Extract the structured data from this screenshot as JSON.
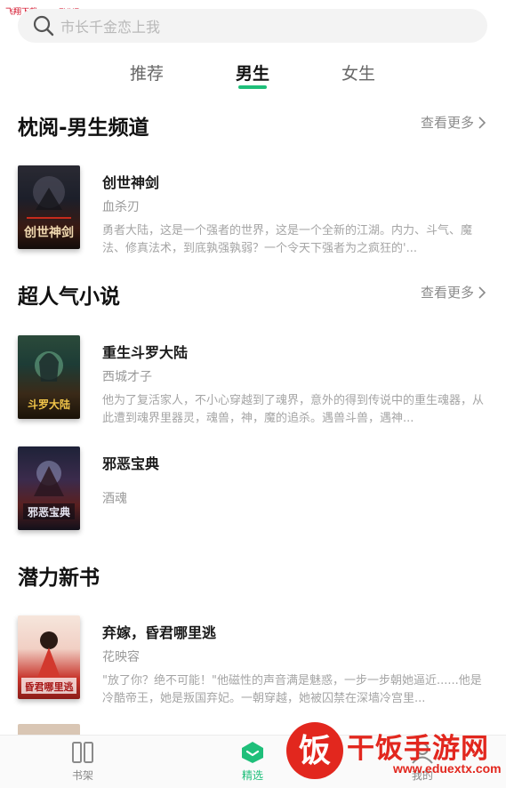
{
  "watermark_top": "飞翔下载 www.FXXZ.com",
  "search": {
    "placeholder": "市长千金恋上我"
  },
  "tabs": [
    {
      "label": "推荐"
    },
    {
      "label": "男生"
    },
    {
      "label": "女生"
    }
  ],
  "sections": [
    {
      "title": "枕阅-男生频道",
      "more": "查看更多",
      "books": [
        {
          "title": "创世神剑",
          "author": "血杀刃",
          "cover_text": "创世神剑",
          "desc": "勇者大陆，这是一个强者的世界，这是一个全新的江湖。内力、斗气、魔法、修真法术，到底孰强孰弱？一个令天下强者为之疯狂的'..."
        }
      ]
    },
    {
      "title": "超人气小说",
      "more": "查看更多",
      "books": [
        {
          "title": "重生斗罗大陆",
          "author": "西城才子",
          "cover_text": "斗罗大陆",
          "desc": "他为了复活家人，不小心穿越到了魂界，意外的得到传说中的重生魂器，从此遭到魂界里器灵，魂兽，神，魔的追杀。遇兽斗兽，遇神..."
        },
        {
          "title": "邪恶宝典",
          "author": "酒魂",
          "cover_text": "邪恶宝典",
          "desc": ""
        }
      ]
    },
    {
      "title": "潜力新书",
      "more": "",
      "books": [
        {
          "title": "弃嫁，昏君哪里逃",
          "author": "花映容",
          "cover_text": "昏君哪里逃",
          "desc": "\"放了你？绝不可能！\"他磁性的声音满是魅惑，一步一步朝她逼近......他是冷酷帝王，她是叛国弃妃。一朝穿越，她被囚禁在深墙冷宫里..."
        }
      ]
    }
  ],
  "bottom_nav": [
    {
      "label": "书架",
      "icon": "bookshelf-icon"
    },
    {
      "label": "精选",
      "icon": "featured-icon"
    },
    {
      "label": "我的",
      "icon": "profile-icon"
    }
  ],
  "brand": {
    "name": "干饭手游网",
    "url": "www.eduextx.com",
    "logo_char": "饭"
  },
  "colors": {
    "accent": "#1fbf7a",
    "brand_red": "#e2271e"
  }
}
